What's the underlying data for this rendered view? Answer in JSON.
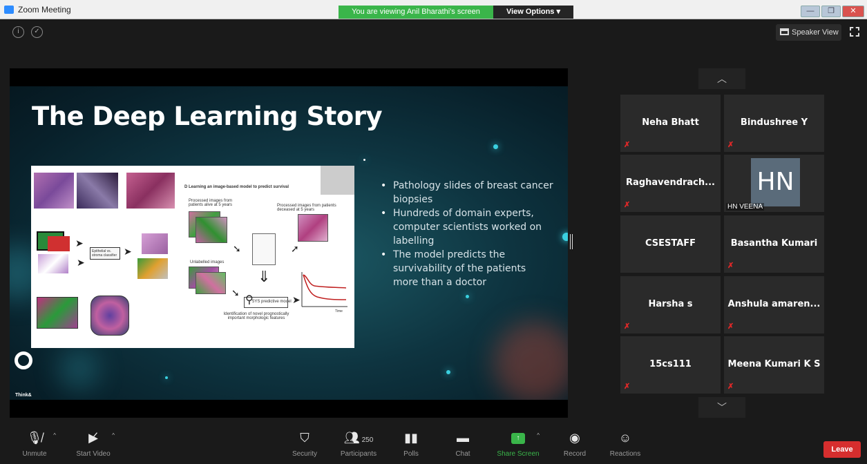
{
  "window": {
    "title": "Zoom Meeting",
    "viewing_banner": "You are viewing Anil Bharathi's screen",
    "view_options": "View Options",
    "speaker_view": "Speaker View"
  },
  "slide": {
    "title": "The Deep Learning Story",
    "bullets": [
      "Pathology slides of breast cancer biopsies",
      "Hundreds of domain experts, computer scientists worked on labelling",
      "The model predicts the survivability of the patients more than a doctor"
    ],
    "brand": "Think&",
    "figure_labels": {
      "d_title": "D  Learning an image-based model to predict survival",
      "alive": "Processed images from patients alive at 5 years",
      "deceased": "Processed images from patients deceased at 5 years",
      "unlabeled": "Unlabelled images",
      "model": "5YS predictive model",
      "features": "Identification of novel prognostically important morphologic features",
      "classifier": "Epithelial vs. stroma classifier",
      "time": "Time"
    }
  },
  "participants": [
    {
      "name": "Neha Bhatt",
      "muted": true
    },
    {
      "name": "Bindushree Y",
      "muted": true
    },
    {
      "name": "Raghavendrach...",
      "muted": true
    },
    {
      "name": "HN VEENA",
      "initials": "HN",
      "muted": false
    },
    {
      "name": "CSESTAFF",
      "muted": false
    },
    {
      "name": "Basantha Kumari",
      "muted": true
    },
    {
      "name": "Harsha s",
      "muted": true
    },
    {
      "name": "Anshula amaren...",
      "muted": true
    },
    {
      "name": "15cs111",
      "muted": true
    },
    {
      "name": "Meena Kumari K S",
      "muted": true
    }
  ],
  "toolbar": {
    "unmute": "Unmute",
    "start_video": "Start Video",
    "security": "Security",
    "participants": "Participants",
    "participant_count": "250",
    "polls": "Polls",
    "chat": "Chat",
    "share_screen": "Share Screen",
    "record": "Record",
    "reactions": "Reactions",
    "leave": "Leave"
  },
  "colors": {
    "share_green": "#3ab54a",
    "leave_red": "#d62e2e",
    "muted_red": "#e02828"
  }
}
